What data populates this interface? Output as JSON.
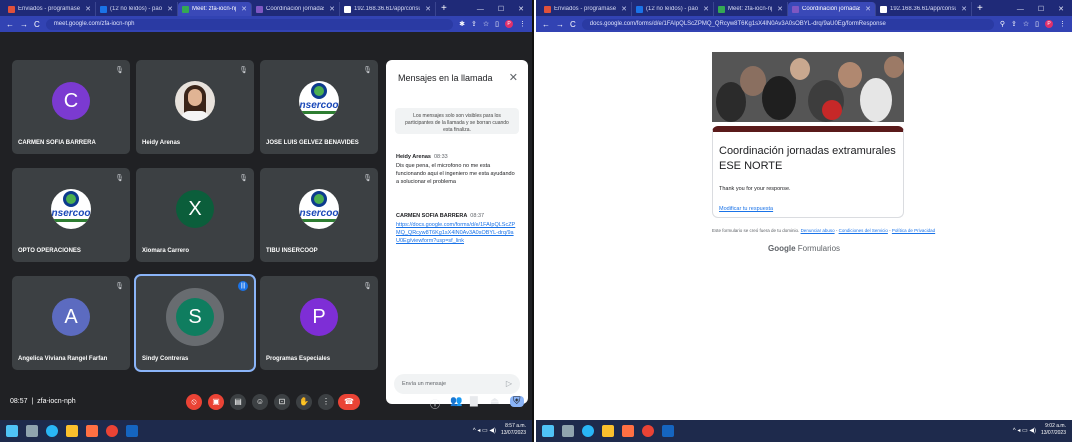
{
  "left_window": {
    "tabs": [
      {
        "label": "Enviados - programasespeci",
        "color": "#e0513b",
        "active": false
      },
      {
        "label": "(12 no leídos) - paola.mogoll",
        "color": "#1a73e8",
        "active": false
      },
      {
        "label": "Meet: zfa-iocn-nph",
        "color": "#34a853",
        "active": true
      },
      {
        "label": "Coordinación jornadas extra",
        "color": "#7e57c2",
        "active": false
      },
      {
        "label": "192.168.36.61/app/consulta",
        "color": "#ffffff",
        "active": false
      }
    ],
    "url": "meet.google.com/zfa-iocn-nph"
  },
  "meet": {
    "participants": [
      {
        "name": "CARMEN SOFIA BARRERA",
        "kind": "initial",
        "initial": "C",
        "color": "#7b3ad1"
      },
      {
        "name": "Heidy Arenas",
        "kind": "photo"
      },
      {
        "name": "JOSE LUIS GELVEZ BENAVIDES",
        "kind": "logo"
      },
      {
        "name": "OPTO OPERACIONES",
        "kind": "logo"
      },
      {
        "name": "Xiomara Carrero",
        "kind": "initial",
        "initial": "X",
        "color": "#0b5e3b"
      },
      {
        "name": "TIBU INSERCOOP",
        "kind": "logo"
      },
      {
        "name": "Angelica Viviana Rangel Farfan",
        "kind": "initial",
        "initial": "A",
        "color": "#5c6bc0"
      },
      {
        "name": "Sindy Contreras",
        "kind": "initial",
        "initial": "S",
        "color": "#0f7d5f",
        "speaking": true
      },
      {
        "name": "Programas Especiales",
        "kind": "initial",
        "initial": "P",
        "color": "#7e2ed6"
      }
    ],
    "logo_text": "nsercoo",
    "chat": {
      "title": "Mensajes en la llamada",
      "note": "Los mensajes solo son visibles para los participantes de la llamada y se borran cuando esta finaliza.",
      "messages": [
        {
          "author": "Heidy Arenas",
          "time": "08:33",
          "text": "Dis que pena, el microfono no me esta funcionando aqui el ingeniero me esta ayudando a solucionar el problema"
        },
        {
          "author": "CARMEN SOFIA BARRERA",
          "time": "08:37",
          "link": "https://docs.google.com/forms/d/e/1FAIpQLScZPMQ_QRcyw8T6Kg1sX4lN0Av3A0sOBYL-drq/9aU0Eg/viewform?usp=sf_link"
        }
      ],
      "input_placeholder": "Envía un mensaje"
    },
    "clock": "08:57",
    "meeting_code": "zfa-iocn-nph"
  },
  "right_window": {
    "tabs": [
      {
        "label": "Enviados - programasespeci",
        "color": "#e0513b",
        "active": false
      },
      {
        "label": "(12 no leídos) - paola.mogoll",
        "color": "#1a73e8",
        "active": false
      },
      {
        "label": "Meet: zfa-iocn-nph",
        "color": "#34a853",
        "active": false
      },
      {
        "label": "Coordinación jornadas extra",
        "color": "#7e57c2",
        "active": true
      },
      {
        "label": "192.168.36.61/app/consulta",
        "color": "#ffffff",
        "active": false
      }
    ],
    "url": "docs.google.com/forms/d/e/1FAIpQLScZPMQ_QRcyw8T6Kg1sX4lN0Av3A0sOBYL-drq/9aU0Eg/formResponse"
  },
  "form": {
    "title": "Coordinación jornadas extramurales ESE NORTE",
    "thanks": "Thank you for your response.",
    "edit_link": "Modificar tu respuesta",
    "footer_prefix": "Este formulario se creó fuera de tu dominio.",
    "footer_links": [
      "Denunciar abuso",
      "Condiciones del Servicio",
      "Política de Privacidad"
    ],
    "brand_google": "Google",
    "brand_forms": "Formularios"
  },
  "taskbar": {
    "left_time": "8:57 a.m.",
    "left_date": "13/07/2023",
    "right_time": "9:02 a.m.",
    "right_date": "13/07/2023"
  }
}
